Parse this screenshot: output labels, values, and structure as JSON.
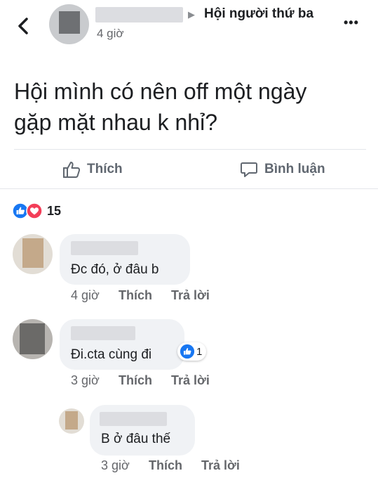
{
  "header": {
    "group_name": "Hội người thứ ba",
    "post_time": "4 giờ",
    "arrow": "▶",
    "more": "•••"
  },
  "post": {
    "text_line1": "Hội mình có nên off một ngày",
    "text_line2": "gặp mặt nhau k nhỉ?"
  },
  "actions": {
    "like_label": "Thích",
    "comment_label": "Bình luận"
  },
  "reactions": {
    "count": "15"
  },
  "comments": [
    {
      "text": "Đc đó, ở đâu b",
      "time": "4 giờ",
      "like": "Thích",
      "reply": "Trả lời"
    },
    {
      "text": "Đi.cta cùng đi",
      "time": "3 giờ",
      "like": "Thích",
      "reply": "Trả lời",
      "reaction_count": "1"
    },
    {
      "text": "B ở đâu thế",
      "time": "3 giờ",
      "like": "Thích",
      "reply": "Trả lời"
    }
  ],
  "colors": {
    "like_blue": "#1877f2",
    "love_red": "#f33e58",
    "text": "#1c1e21",
    "meta": "#65676b",
    "bubble": "#f0f2f5"
  }
}
